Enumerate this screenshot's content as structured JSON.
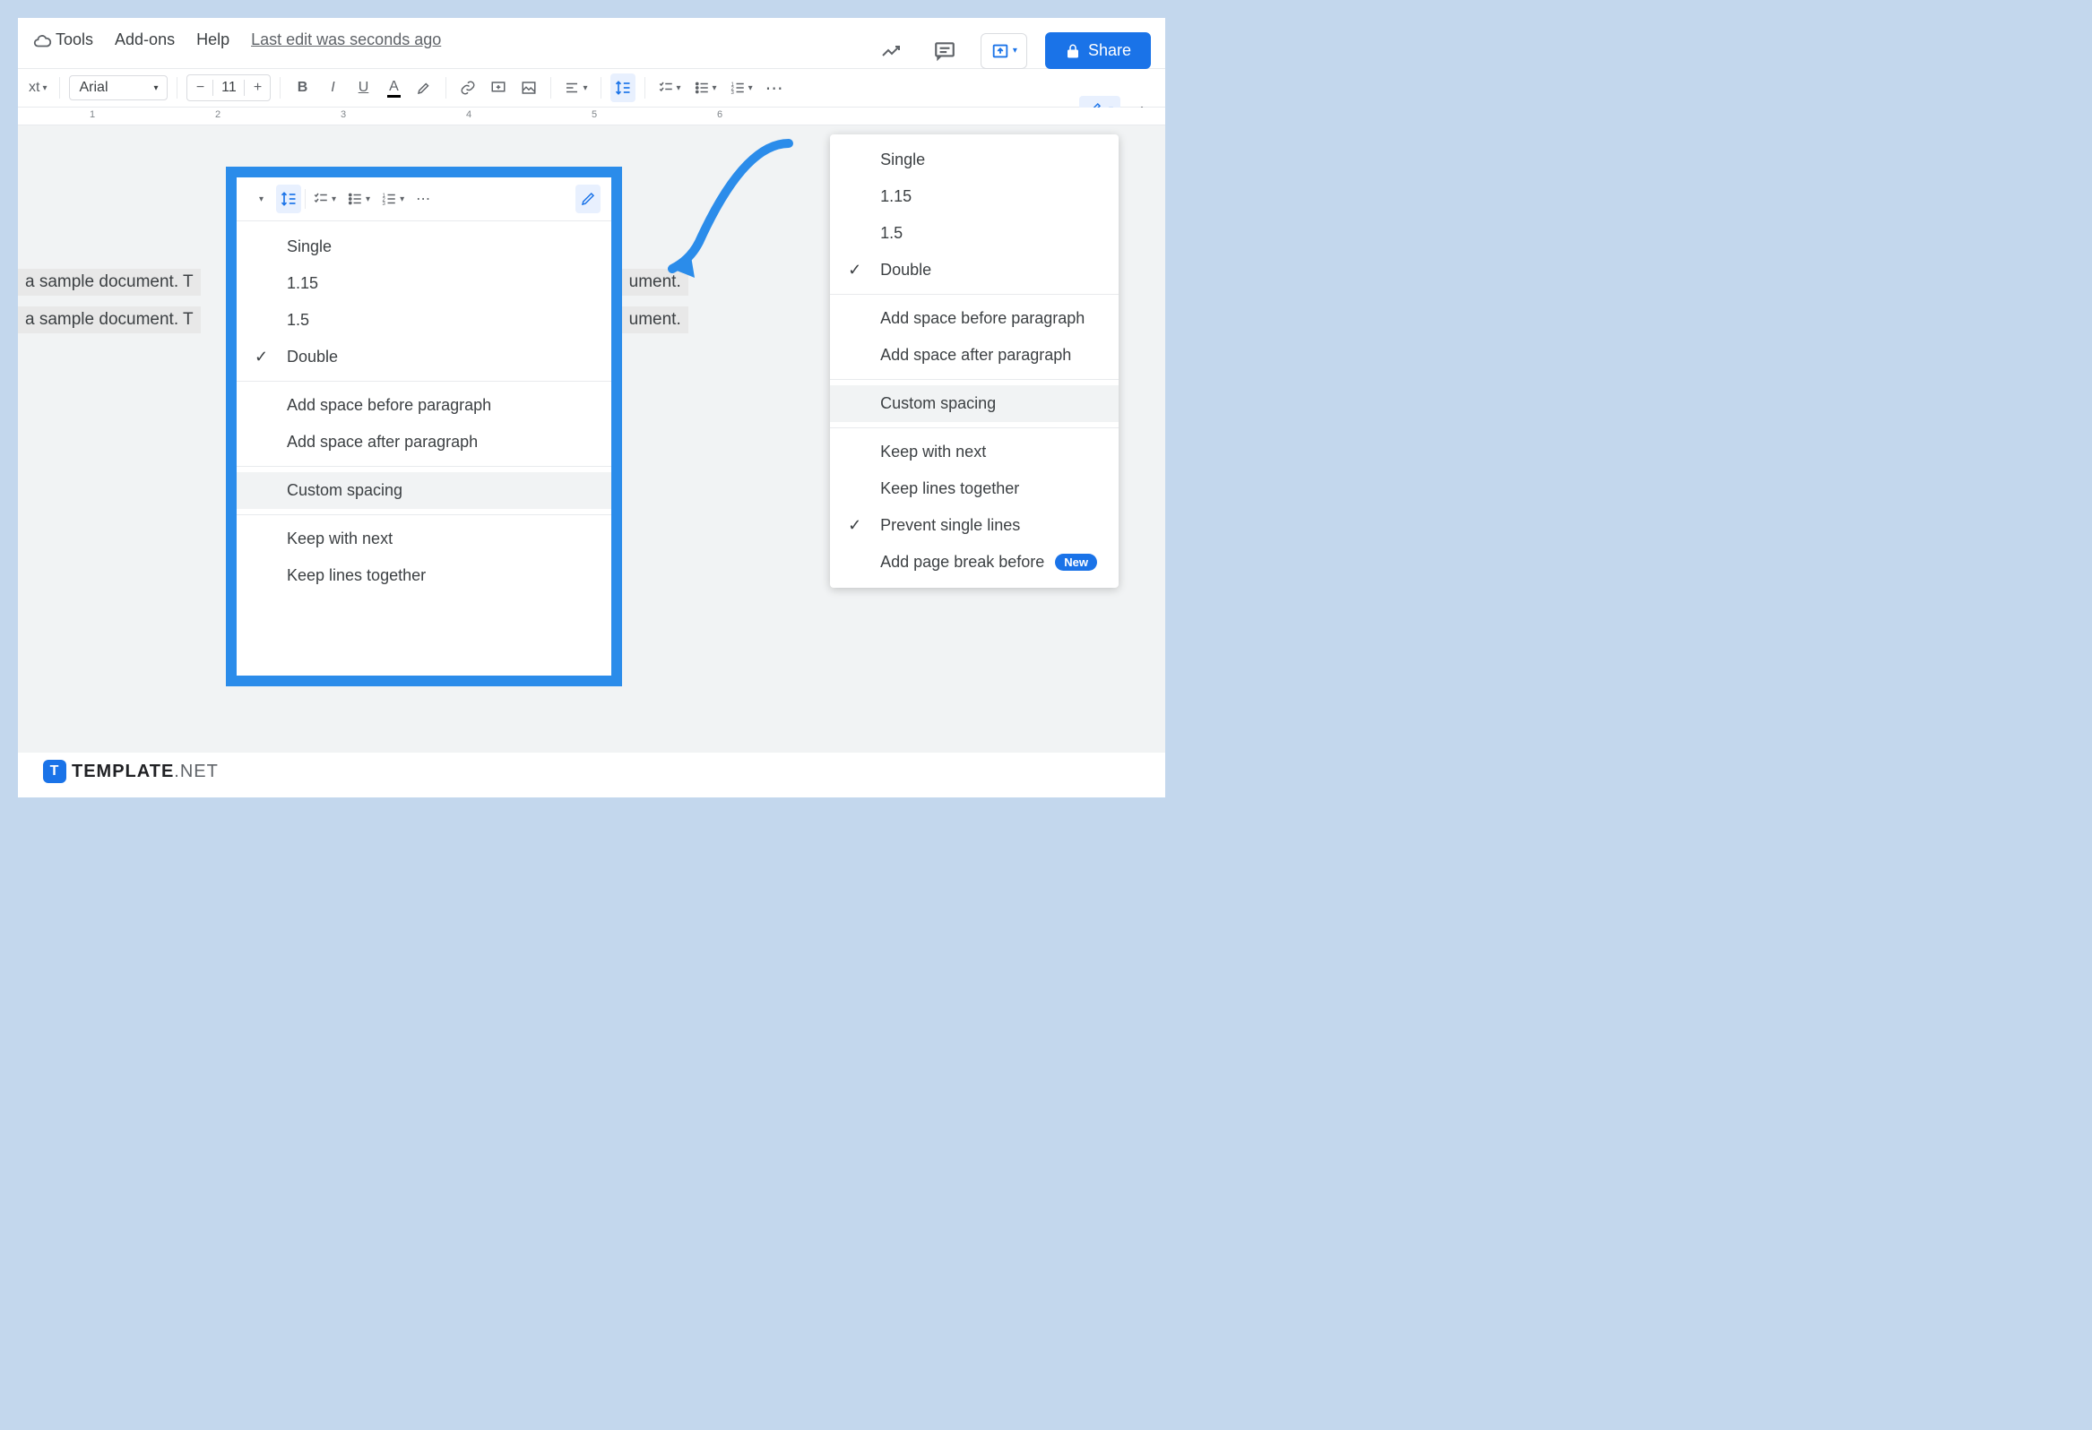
{
  "menubar": {
    "tools": "Tools",
    "addons": "Add-ons",
    "help": "Help",
    "last_edit": "Last edit was seconds ago"
  },
  "share": {
    "label": "Share"
  },
  "toolbar": {
    "style_text": "xt",
    "font": "Arial",
    "size": "11",
    "more": "⋯"
  },
  "ruler": [
    "1",
    "2",
    "3",
    "4",
    "5",
    "6"
  ],
  "doc": {
    "line1": "a sample document. T",
    "line1b": "ument.",
    "line2": "a sample document. T",
    "line2b": "ument."
  },
  "linespacing_menu": {
    "single": "Single",
    "v115": "1.15",
    "v15": "1.5",
    "double": "Double",
    "add_before": "Add space before paragraph",
    "add_after": "Add space after paragraph",
    "custom": "Custom spacing",
    "keep_next": "Keep with next",
    "keep_lines": "Keep lines together",
    "prevent": "Prevent single lines",
    "page_break": "Add page break before",
    "new_badge": "New"
  },
  "watermark": {
    "brand": "TEMPLATE",
    "suffix": ".NET"
  }
}
